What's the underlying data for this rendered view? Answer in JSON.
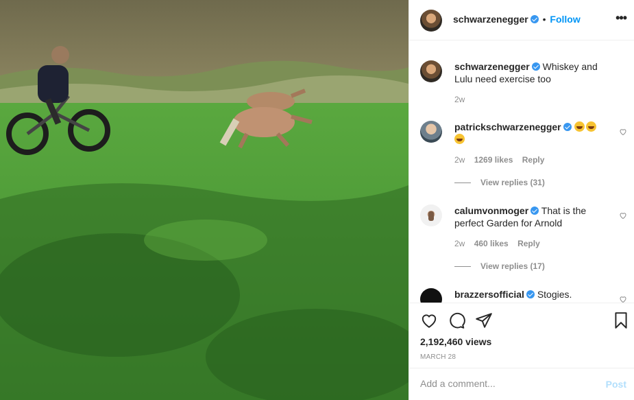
{
  "header": {
    "username": "schwarzenegger",
    "separator": "•",
    "follow_label": "Follow",
    "more_label": "•••"
  },
  "caption": {
    "username": "schwarzenegger",
    "text": "Whiskey and Lulu need exercise too",
    "time": "2w"
  },
  "comments": [
    {
      "username": "patrickschwarzenegger",
      "text": "",
      "emoji_count": 3,
      "time": "2w",
      "likes": "1269 likes",
      "reply_label": "Reply",
      "view_replies": "View replies (31)"
    },
    {
      "username": "calumvonmoger",
      "text": "That is the perfect Garden for Arnold",
      "time": "2w",
      "likes": "460 likes",
      "reply_label": "Reply",
      "view_replies": "View replies (17)"
    },
    {
      "username": "brazzersofficial",
      "text": "Stogies."
    }
  ],
  "actions": {
    "icons": [
      "heart-icon",
      "comment-icon",
      "share-icon",
      "bookmark-icon"
    ],
    "views": "2,192,460 views",
    "date": "MARCH 28"
  },
  "add_comment": {
    "placeholder": "Add a comment...",
    "post_label": "Post"
  },
  "colors": {
    "link": "#0095f6",
    "verified": "#3897f0",
    "muted": "#8e8e8e",
    "post_disabled": "#b2dffc",
    "grass": "#4f9a3a"
  }
}
